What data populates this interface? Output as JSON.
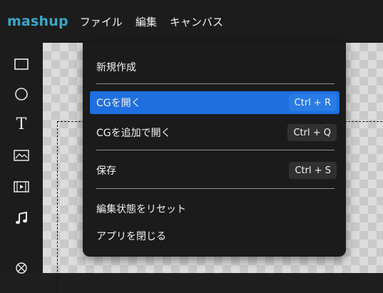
{
  "app": {
    "brand": "mashup"
  },
  "menubar": {
    "items": [
      "ファイル",
      "編集",
      "キャンバス"
    ]
  },
  "toolbar": {
    "tools": [
      "rectangle-tool",
      "ellipse-tool",
      "text-tool",
      "image-tool",
      "video-tool",
      "audio-tool",
      "shape-tool"
    ],
    "text_tool_glyph": "T"
  },
  "file_menu": {
    "items": [
      {
        "label": "新規作成",
        "shortcut": ""
      },
      {
        "label": "CGを開く",
        "shortcut": "Ctrl + R",
        "highlighted": true
      },
      {
        "label": "CGを追加で開く",
        "shortcut": "Ctrl + Q"
      },
      {
        "label": "保存",
        "shortcut": "Ctrl + S"
      },
      {
        "label": "編集状態をリセット",
        "shortcut": ""
      },
      {
        "label": "アプリを閉じる",
        "shortcut": ""
      }
    ]
  },
  "colors": {
    "brand": "#3aa7c7",
    "highlight": "#1f6fe0"
  }
}
